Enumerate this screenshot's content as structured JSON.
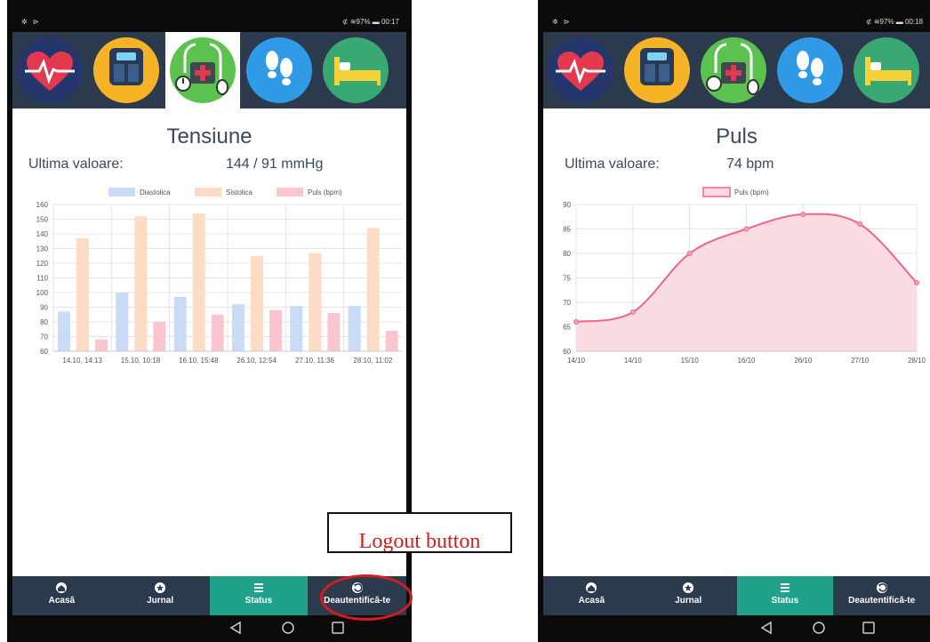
{
  "left": {
    "status": {
      "left": "✲ ⊳",
      "right": "⊄ ≋97% ▬ 00:17"
    },
    "title": "Tensiune",
    "last_label": "Ultima valoare:",
    "last_value": "144 / 91 mmHg",
    "selected_icon": "blood-pressure-icon"
  },
  "right": {
    "status": {
      "left": "✲ ⊳",
      "right": "⊄ ≋97% ▬ 00:18"
    },
    "title": "Puls",
    "last_label": "Ultima valoare:",
    "last_value": "74 bpm",
    "selected_icon": "none"
  },
  "icons": [
    "heart-rate-icon",
    "weight-scale-icon",
    "blood-pressure-icon",
    "steps-icon",
    "sleep-icon"
  ],
  "nav": [
    "Acasă",
    "Jurnal",
    "Status",
    "Deautentifică-te"
  ],
  "nav_active": "Status",
  "annotation": {
    "text": "Logout button"
  },
  "colors": {
    "navbar": "#2b3a4c",
    "active": "#1fa18a",
    "text": "#384a5e",
    "annotation": "#d61c1c"
  },
  "chart_data": [
    {
      "type": "bar",
      "categories": [
        "14.10, 14:13",
        "15.10, 10:18",
        "16.10, 15:48",
        "26.10, 12:54",
        "27.10, 11:36",
        "28.10, 11:02"
      ],
      "series": [
        {
          "name": "Diastolica",
          "values": [
            87,
            100,
            97,
            92,
            91,
            91
          ],
          "color": "#c9dbf6"
        },
        {
          "name": "Sistolica",
          "values": [
            137,
            152,
            154,
            125,
            127,
            144
          ],
          "color": "#fddcc5"
        },
        {
          "name": "Puls (bpm)",
          "values": [
            68,
            80,
            85,
            88,
            86,
            74
          ],
          "color": "#f9c6d0"
        }
      ],
      "ylim": [
        60,
        160
      ],
      "yticks": [
        60,
        70,
        80,
        90,
        100,
        110,
        120,
        130,
        140,
        150,
        160
      ],
      "grid": true,
      "legend": "top"
    },
    {
      "type": "area",
      "categories": [
        "14/10",
        "14/10",
        "15/10",
        "16/10",
        "26/10",
        "27/10",
        "28/10"
      ],
      "series": [
        {
          "name": "Puls (bpm)",
          "values": [
            66,
            68,
            80,
            85,
            88,
            86,
            74
          ],
          "color": "#f06485"
        }
      ],
      "ylim": [
        60,
        90
      ],
      "yticks": [
        60,
        65,
        70,
        75,
        80,
        85,
        90
      ],
      "grid": true,
      "legend": "top"
    }
  ]
}
